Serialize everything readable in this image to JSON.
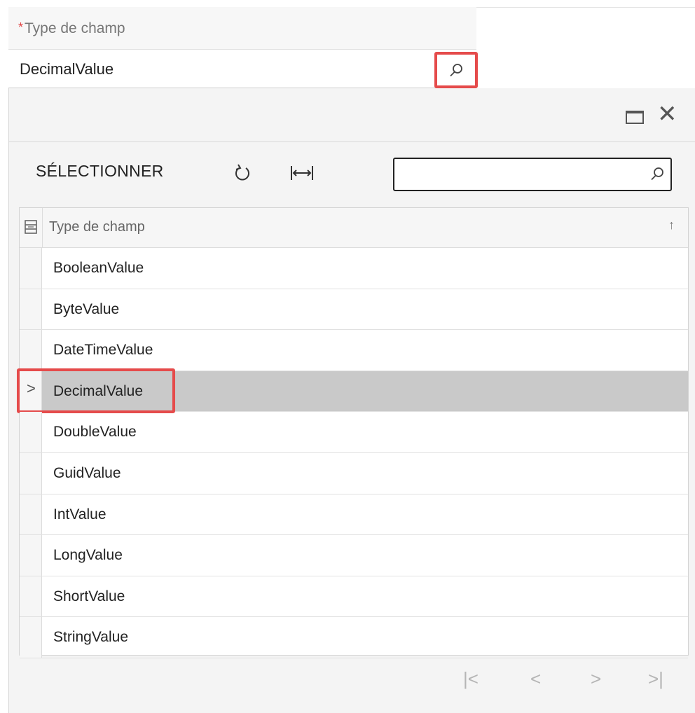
{
  "field": {
    "required_marker": "*",
    "label": "Type de champ",
    "value": "DecimalValue",
    "lookup_icon": "search-icon"
  },
  "panel": {
    "window_icons": [
      "maximize-icon",
      "close-icon"
    ],
    "close_glyph": "✕"
  },
  "toolbar": {
    "select_label": "SÉLECTIONNER",
    "refresh_icon": "refresh-icon",
    "fit_icon": "fit-columns-icon",
    "search_placeholder": "",
    "search_value": ""
  },
  "grid": {
    "column_header": "Type de champ",
    "sort_glyph": "↑",
    "rows": [
      "BooleanValue",
      "ByteValue",
      "DateTimeValue",
      "DecimalValue",
      "DoubleValue",
      "GuidValue",
      "IntValue",
      "LongValue",
      "ShortValue",
      "StringValue"
    ],
    "selected_row": "DecimalValue"
  },
  "pager": {
    "first": "|<",
    "prev": "<",
    "next": ">",
    "last": ">|"
  },
  "colors": {
    "highlight": "#e54b4b",
    "selected_row": "#c9c9c9"
  }
}
